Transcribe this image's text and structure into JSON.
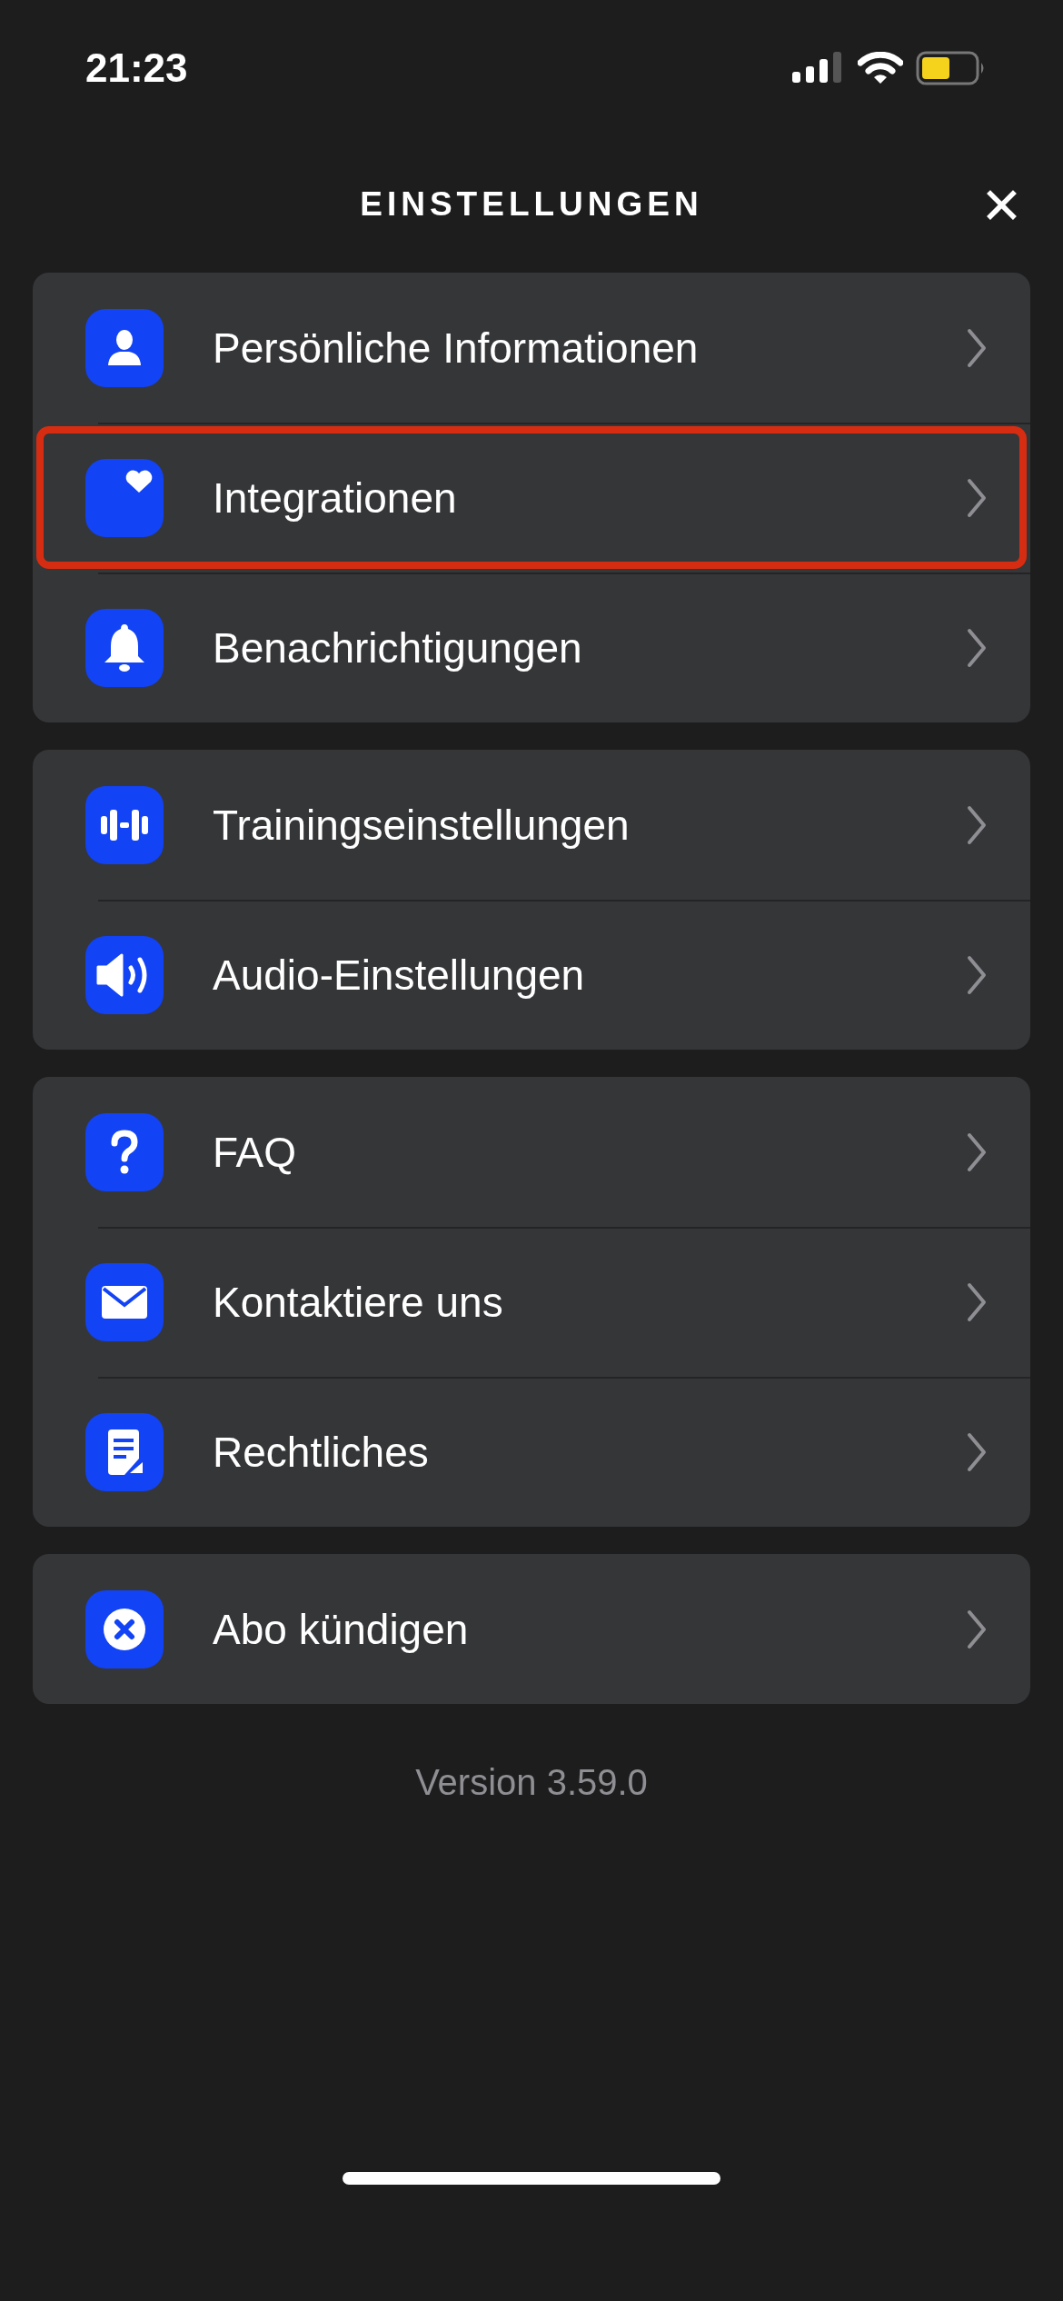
{
  "status_bar": {
    "time": "21:23"
  },
  "header": {
    "title": "EINSTELLUNGEN",
    "close": "✕"
  },
  "groups": [
    {
      "items": [
        {
          "label": "Persönliche Informationen",
          "kind": "person",
          "highlighted": false
        },
        {
          "label": "Integrationen",
          "kind": "heart",
          "highlighted": true
        },
        {
          "label": "Benachrichtigungen",
          "kind": "bell",
          "highlighted": false
        }
      ]
    },
    {
      "items": [
        {
          "label": "Trainingseinstellungen",
          "kind": "dumbbell",
          "highlighted": false
        },
        {
          "label": "Audio-Einstellungen",
          "kind": "speaker",
          "highlighted": false
        }
      ]
    },
    {
      "items": [
        {
          "label": "FAQ",
          "kind": "question",
          "highlighted": false
        },
        {
          "label": "Kontaktiere uns",
          "kind": "mail",
          "highlighted": false
        },
        {
          "label": "Rechtliches",
          "kind": "document",
          "highlighted": false
        }
      ]
    },
    {
      "items": [
        {
          "label": "Abo kündigen",
          "kind": "cancel",
          "highlighted": false
        }
      ]
    }
  ],
  "version": "Version 3.59.0"
}
